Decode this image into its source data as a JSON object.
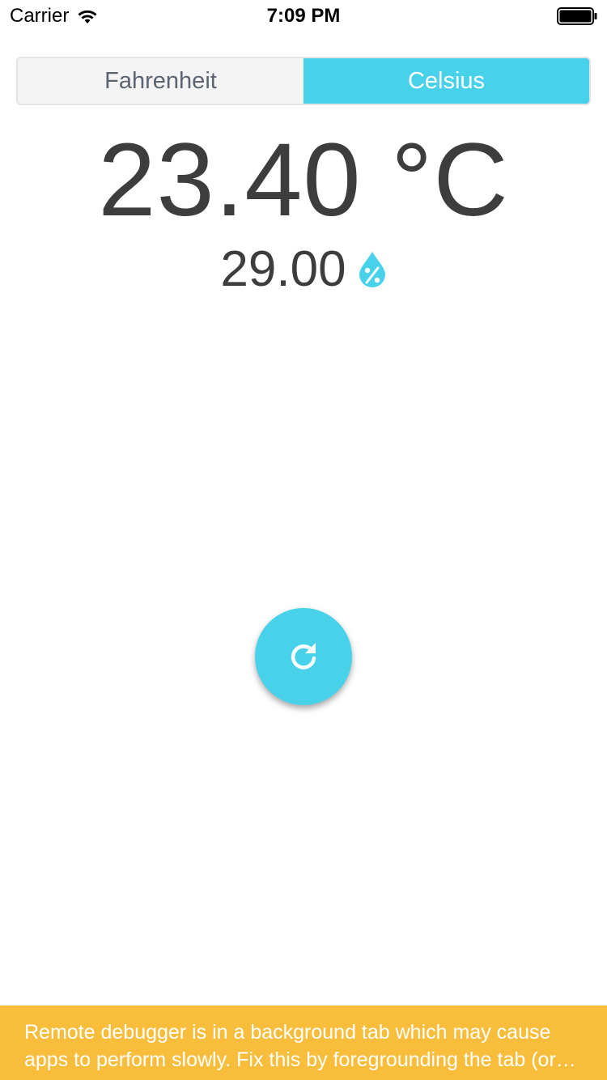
{
  "status_bar": {
    "carrier": "Carrier",
    "time": "7:09 PM"
  },
  "units": {
    "options": [
      {
        "label": "Fahrenheit",
        "selected": false
      },
      {
        "label": "Celsius",
        "selected": true
      }
    ]
  },
  "reading": {
    "temperature": "23.40 °C",
    "humidity": "29.00"
  },
  "icons": {
    "humidity": "water-drop-percent-icon",
    "refresh": "refresh-icon"
  },
  "colors": {
    "accent": "#48d2ea",
    "text": "#3d3d3d",
    "warning": "#f9bd3c"
  },
  "banner": {
    "message": "Remote debugger is in a background tab which may cause apps to perform slowly. Fix this by foregrounding the tab (or opening it in a separate window)."
  }
}
